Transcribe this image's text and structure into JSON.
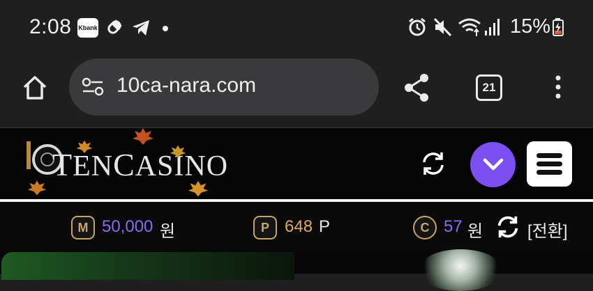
{
  "status_bar": {
    "time": "2:08",
    "kbank_label": "Kbank",
    "battery_percent": "15%",
    "icons": [
      "kbank-app-icon",
      "pill-icon",
      "telegram-icon",
      "notification-dot",
      "alarm-icon",
      "mute-icon",
      "wifi-icon",
      "signal-icon",
      "battery-charging-icon"
    ]
  },
  "browser": {
    "url": "10ca-nara.com",
    "tab_count": "21",
    "icons": [
      "home-icon",
      "site-settings-icon",
      "share-icon",
      "tabs-icon",
      "more-menu-icon"
    ]
  },
  "site": {
    "logo_text_t": "T",
    "logo_text_en": "EN",
    "logo_text_c": "C",
    "logo_text_asino": "ASINO",
    "accent_color": "#7b4ff0",
    "coin_color": "#c9a46a"
  },
  "balances": {
    "money": {
      "badge": "M",
      "amount": "50,000",
      "unit": "원",
      "color": "#8b6cf0"
    },
    "point": {
      "badge": "P",
      "amount": "648",
      "unit": "P",
      "color": "#e0a85a"
    },
    "casino": {
      "badge": "C",
      "amount": "57",
      "unit": "원",
      "color": "#8b6cf0"
    },
    "switch_label": "[전환]"
  }
}
